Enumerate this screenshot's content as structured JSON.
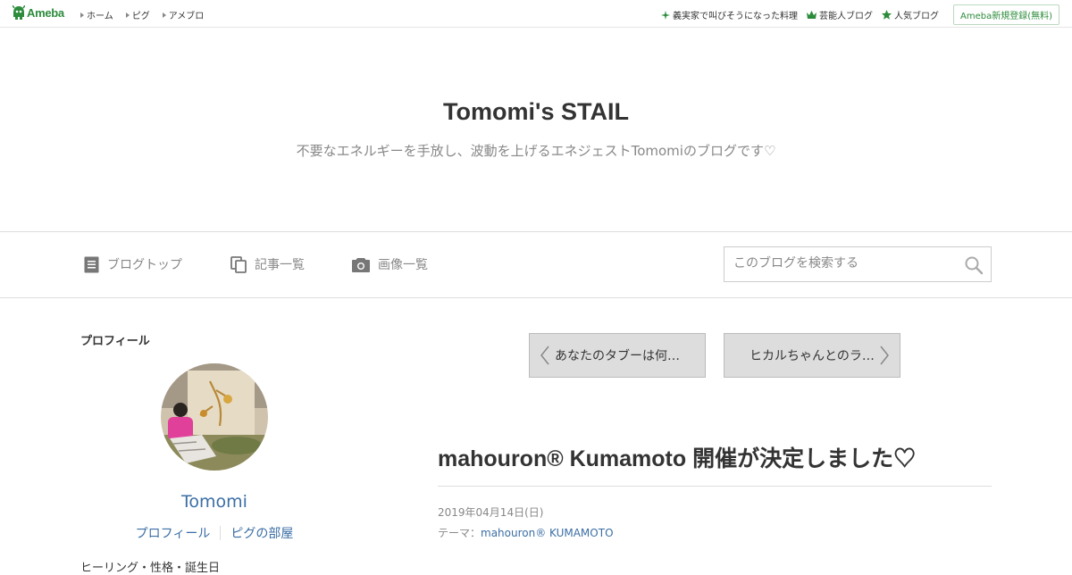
{
  "topbar": {
    "logo_text": "Ameba",
    "nav": [
      {
        "label": "ホーム"
      },
      {
        "label": "ピグ"
      },
      {
        "label": "アメブロ"
      }
    ],
    "right_links": [
      {
        "label": "義実家で叫びそうになった料理",
        "icon": "sparkle-icon"
      },
      {
        "label": "芸能人ブログ",
        "icon": "crown-icon"
      },
      {
        "label": "人気ブログ",
        "icon": "star-icon"
      }
    ],
    "signup_label": "Ameba新規登録(無料)",
    "brand_color": "#2d8c3c"
  },
  "header": {
    "title": "Tomomi's STAIL",
    "description": "不要なエネルギーを手放し、波動を上げるエネジェストTomomiのブログです♡"
  },
  "navbar": {
    "items": [
      {
        "label": "ブログトップ",
        "icon": "document-icon"
      },
      {
        "label": "記事一覧",
        "icon": "copy-icon"
      },
      {
        "label": "画像一覧",
        "icon": "camera-icon"
      }
    ],
    "search_placeholder": "このブログを検索する"
  },
  "sidebar": {
    "heading": "プロフィール",
    "name": "Tomomi",
    "links": [
      "プロフィール",
      "ピグの部屋"
    ],
    "cut_text": "ヒーリング・性格・誕生日"
  },
  "article": {
    "prev_label": "あなたのタブーは何…",
    "next_label": "ヒカルちゃんとのラ…",
    "title": "mahouron® Kumamoto 開催が決定しました♡",
    "date": "2019年04月14日(日)",
    "theme_prefix": "テーマ：",
    "theme_link": "mahouron® KUMAMOTO",
    "link_color": "#3b6ea5"
  }
}
